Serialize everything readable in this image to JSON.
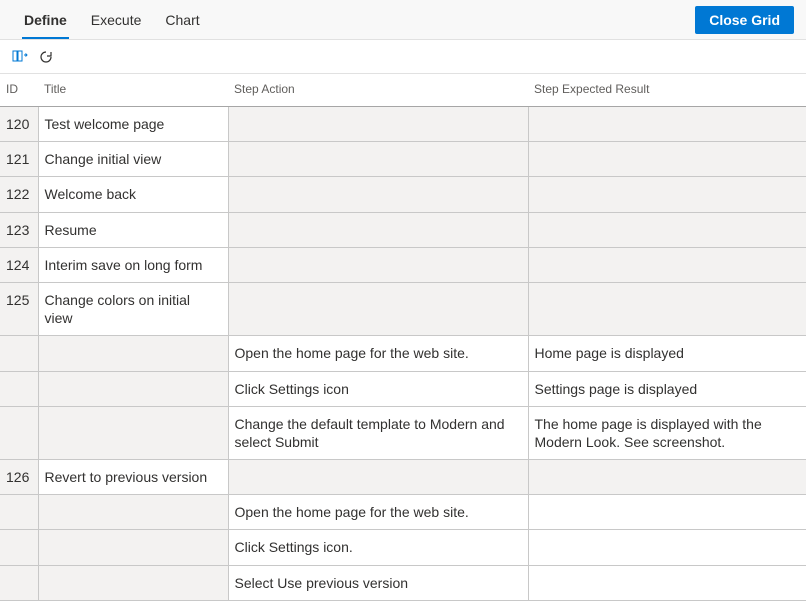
{
  "tabs": {
    "define": "Define",
    "execute": "Execute",
    "chart": "Chart"
  },
  "buttons": {
    "close_grid": "Close Grid"
  },
  "columns": {
    "id": "ID",
    "title": "Title",
    "step_action": "Step Action",
    "step_expected": "Step Expected Result"
  },
  "rows": [
    {
      "id": "120",
      "title": "Test welcome page",
      "action": "",
      "expected": ""
    },
    {
      "id": "121",
      "title": "Change initial view",
      "action": "",
      "expected": ""
    },
    {
      "id": "122",
      "title": "Welcome back",
      "action": "",
      "expected": ""
    },
    {
      "id": "123",
      "title": "Resume",
      "action": "",
      "expected": ""
    },
    {
      "id": "124",
      "title": "Interim save on long form",
      "action": "",
      "expected": ""
    },
    {
      "id": "125",
      "title": "Change colors on initial view",
      "action": "",
      "expected": ""
    },
    {
      "id": "",
      "title": "",
      "action": "Open the home page for the web site.",
      "expected": "Home page is displayed"
    },
    {
      "id": "",
      "title": "",
      "action": "Click Settings icon",
      "expected": "Settings page is displayed"
    },
    {
      "id": "",
      "title": "",
      "action": "Change the default template to Modern and select Submit",
      "expected": "The home page is displayed with the Modern Look. See screenshot."
    },
    {
      "id": "126",
      "title": "Revert to previous version",
      "action": "",
      "expected": ""
    },
    {
      "id": "",
      "title": "",
      "action": "Open the home page for the web site.",
      "expected": ""
    },
    {
      "id": "",
      "title": "",
      "action": "Click Settings icon.",
      "expected": ""
    },
    {
      "id": "",
      "title": "",
      "action": "Select Use previous version",
      "expected": ""
    }
  ]
}
